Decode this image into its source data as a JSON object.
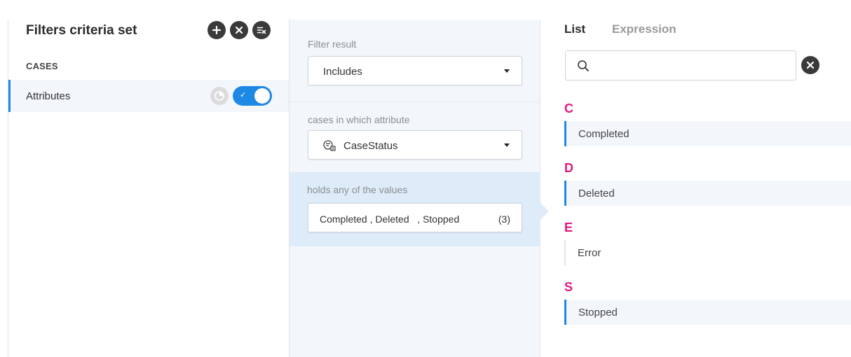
{
  "left": {
    "title": "Filters criteria set",
    "section_label": "CASES",
    "attribute_row": {
      "label": "Attributes",
      "toggle_on": true
    }
  },
  "middle": {
    "filter_result_label": "Filter result",
    "filter_result_value": "Includes",
    "attribute_label": "cases in which attribute",
    "attribute_value": "CaseStatus",
    "values_label": "holds any of the values",
    "values_text": "Completed , Deleted   , Stopped",
    "values_count": "(3)"
  },
  "right": {
    "tabs": [
      {
        "label": "List",
        "active": true
      },
      {
        "label": "Expression",
        "active": false
      }
    ],
    "search": {
      "placeholder": "",
      "value": ""
    },
    "groups": [
      {
        "letter": "C",
        "items": [
          {
            "label": "Completed",
            "selected": true
          }
        ]
      },
      {
        "letter": "D",
        "items": [
          {
            "label": "Deleted",
            "selected": true
          }
        ]
      },
      {
        "letter": "E",
        "items": [
          {
            "label": "Error",
            "selected": false
          }
        ]
      },
      {
        "letter": "S",
        "items": [
          {
            "label": "Stopped",
            "selected": true
          }
        ]
      }
    ]
  },
  "colors": {
    "accent": "#1e88e5",
    "letter": "#e0197d",
    "dark_button": "#3a3a3a",
    "panel_bg": "#f3f7fb",
    "selected_section_bg": "#deebf8"
  },
  "icons": [
    "add-icon",
    "close-icon",
    "clear-filter-icon",
    "pie-chart-icon",
    "check-icon",
    "search-icon",
    "attribute-icon",
    "dropdown-caret-icon"
  ]
}
